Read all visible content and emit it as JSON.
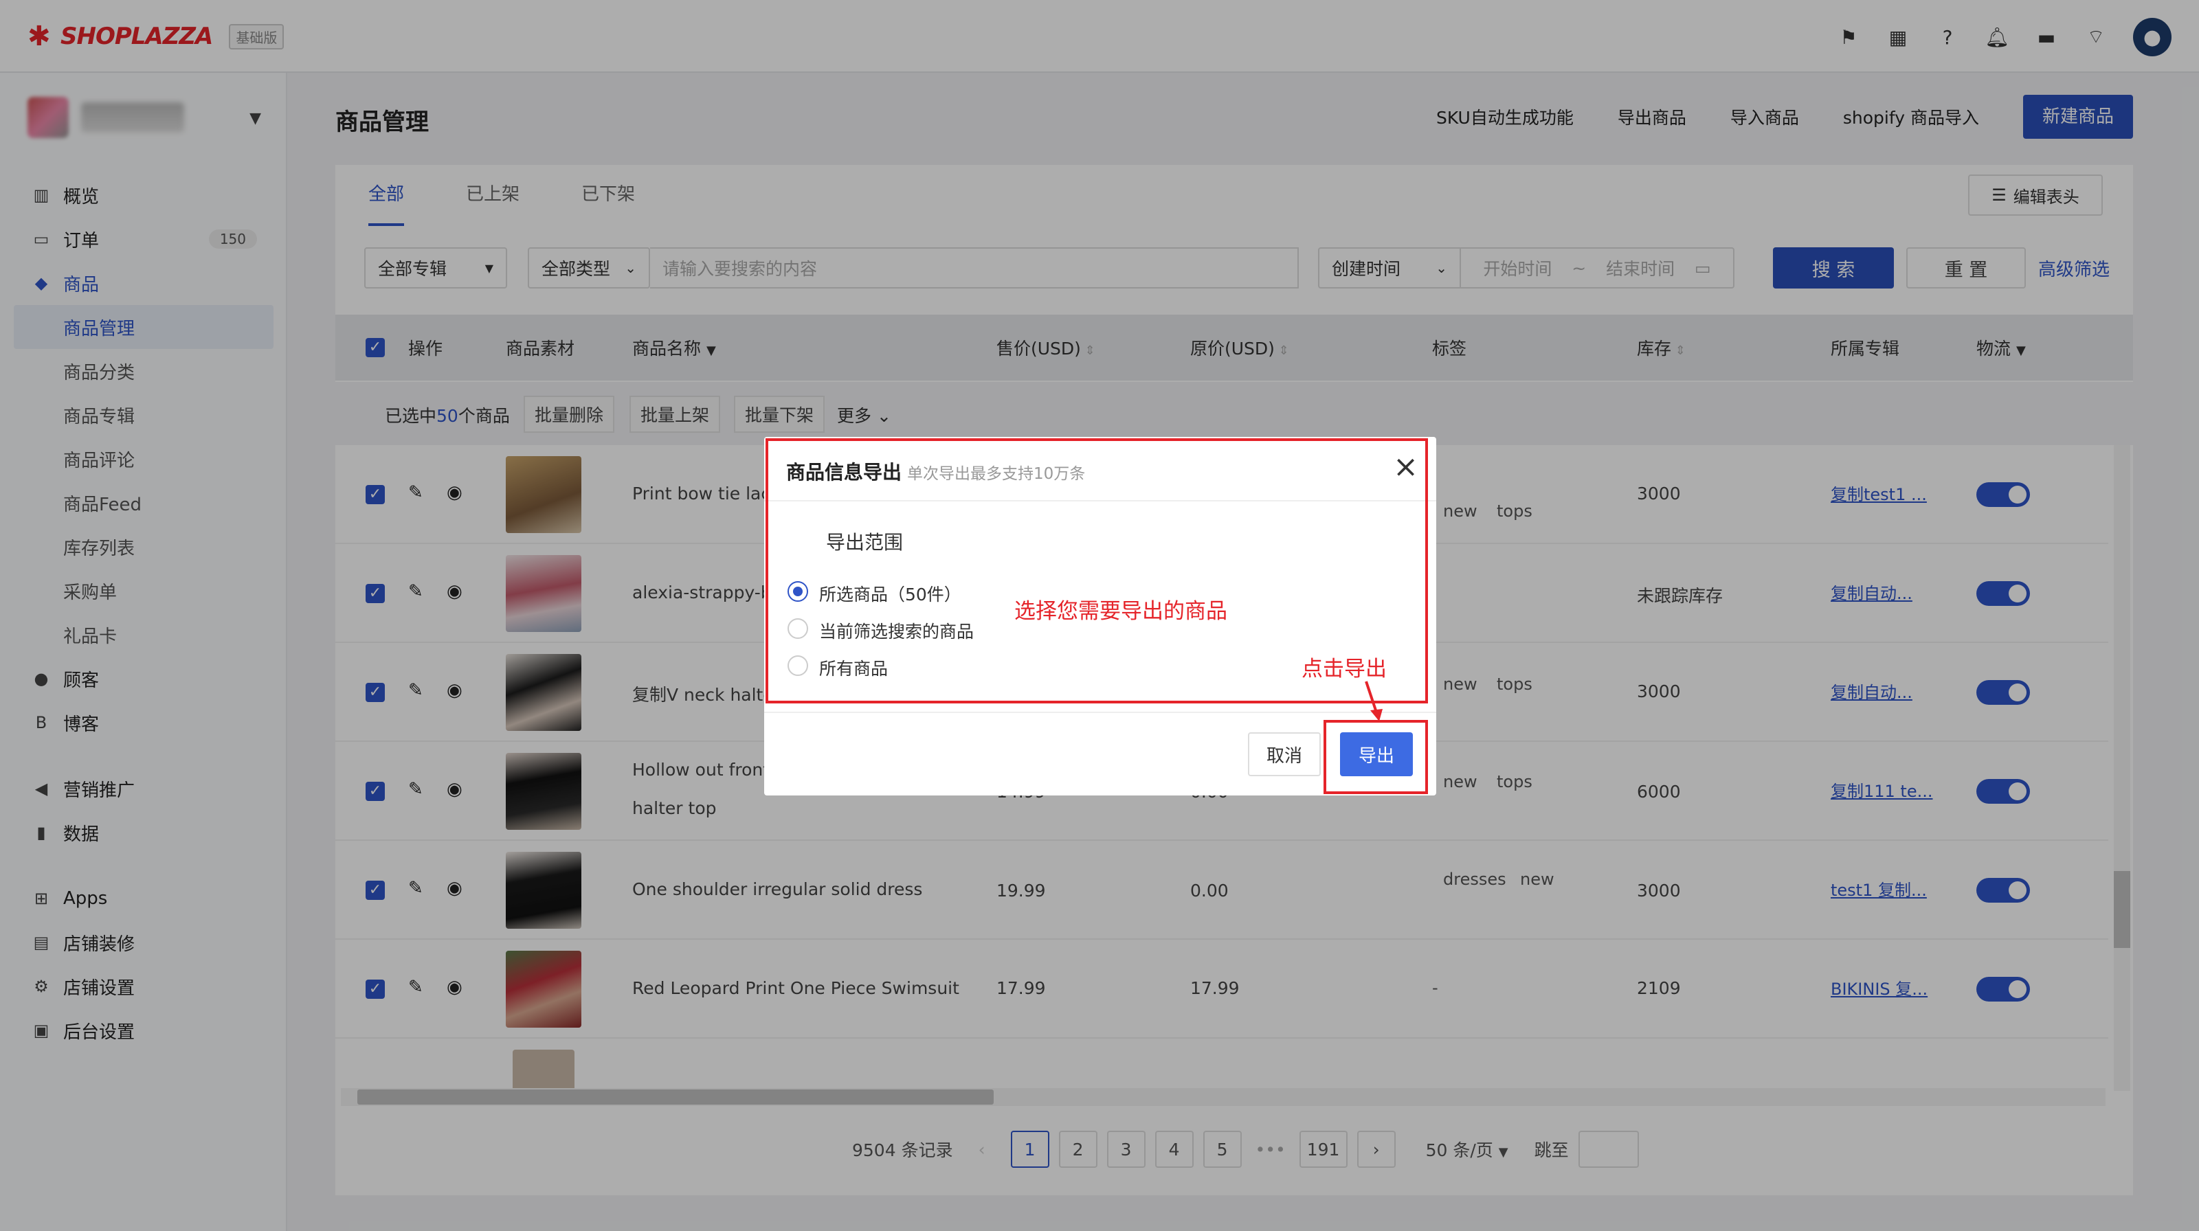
{
  "brand": {
    "name": "SHOPLAZZA",
    "edition": "基础版"
  },
  "topbar": {
    "icons": [
      "flag-icon",
      "store-icon",
      "help-icon",
      "bell-icon",
      "message-icon",
      "wifi-icon",
      "user-avatar"
    ]
  },
  "sidebar": {
    "items": [
      {
        "label": "概览",
        "icon": "overview-icon"
      },
      {
        "label": "订单",
        "icon": "order-icon",
        "badge": "150"
      },
      {
        "label": "商品",
        "icon": "product-icon"
      },
      {
        "label": "商品管理"
      },
      {
        "label": "商品分类"
      },
      {
        "label": "商品专辑"
      },
      {
        "label": "商品评论"
      },
      {
        "label": "商品Feed"
      },
      {
        "label": "库存列表"
      },
      {
        "label": "采购单"
      },
      {
        "label": "礼品卡"
      },
      {
        "label": "顾客",
        "icon": "customer-icon"
      },
      {
        "label": "博客",
        "icon": "blog-icon"
      },
      {
        "label": "营销推广",
        "icon": "marketing-icon"
      },
      {
        "label": "数据",
        "icon": "data-icon"
      },
      {
        "label": "Apps",
        "icon": "apps-icon"
      },
      {
        "label": "店铺装修",
        "icon": "decor-icon"
      },
      {
        "label": "店铺设置",
        "icon": "settings-icon"
      },
      {
        "label": "后台设置",
        "icon": "admin-icon"
      }
    ]
  },
  "page": {
    "title": "商品管理",
    "actions": [
      "SKU自动生成功能",
      "导出商品",
      "导入商品",
      "shopify 商品导入"
    ],
    "new_button": "新建商品"
  },
  "tabs": [
    "全部",
    "已上架",
    "已下架"
  ],
  "edit_header": "编辑表头",
  "filters": {
    "collection": "全部专辑",
    "type": "全部类型",
    "search_placeholder": "请输入要搜索的内容",
    "time_field": "创建时间",
    "start_placeholder": "开始时间",
    "range_sep": "~",
    "end_placeholder": "结束时间",
    "search": "搜 索",
    "reset": "重 置",
    "advanced": "高级筛选"
  },
  "table": {
    "headers": [
      "操作",
      "商品素材",
      "商品名称",
      "售价(USD)",
      "原价(USD)",
      "标签",
      "库存",
      "所属专辑",
      "物流"
    ],
    "batch": {
      "prefix": "已选中",
      "count": "50",
      "suffix": "个商品",
      "delete": "批量删除",
      "publish": "批量上架",
      "unpublish": "批量下架",
      "more": "更多"
    },
    "rows": [
      {
        "name": "Print bow tie lace",
        "price": "",
        "original": "",
        "tags": [
          "new",
          "tops"
        ],
        "stock": "3000",
        "collection": "复制test1 ..."
      },
      {
        "name": "alexia-strappy-bo",
        "price": "",
        "original": "",
        "tags": [],
        "stock": "未跟踪库存",
        "collection": "复制自动..."
      },
      {
        "name": "复制V neck halter",
        "price": "",
        "original": "",
        "tags": [
          "new",
          "tops"
        ],
        "stock": "3000",
        "collection": "复制自动..."
      },
      {
        "name": "Hollow out front ruffled open back solid",
        "name2": "halter top",
        "price": "14.99",
        "original": "0.00",
        "tags": [
          "new",
          "tops"
        ],
        "stock": "6000",
        "collection": "复制111 te..."
      },
      {
        "name": "One shoulder irregular solid dress",
        "price": "19.99",
        "original": "0.00",
        "tags": [
          "dresses",
          "new"
        ],
        "stock": "3000",
        "collection": "test1 复制..."
      },
      {
        "name": "Red Leopard Print One Piece Swimsuit",
        "price": "17.99",
        "original": "17.99",
        "tags": [
          "-"
        ],
        "stock": "2109",
        "collection": "BIKINIS 复..."
      }
    ]
  },
  "pagination": {
    "total": "9504 条记录",
    "pages": [
      "1",
      "2",
      "3",
      "4",
      "5",
      "•••",
      "191"
    ],
    "current": "1",
    "page_size": "50 条/页",
    "jump": "跳至"
  },
  "modal": {
    "title": "商品信息导出",
    "subtitle": "单次导出最多支持10万条",
    "range_label": "导出范围",
    "options": [
      "所选商品（50件）",
      "当前筛选搜索的商品",
      "所有商品"
    ],
    "selected": "所选商品（50件）",
    "cancel": "取消",
    "export": "导出"
  },
  "annotations": {
    "select": "选择您需要导出的商品",
    "click": "点击导出"
  },
  "colors": {
    "accent": "#2f54c7",
    "annotation": "#e5242a",
    "export_button": "#3d6be3"
  }
}
